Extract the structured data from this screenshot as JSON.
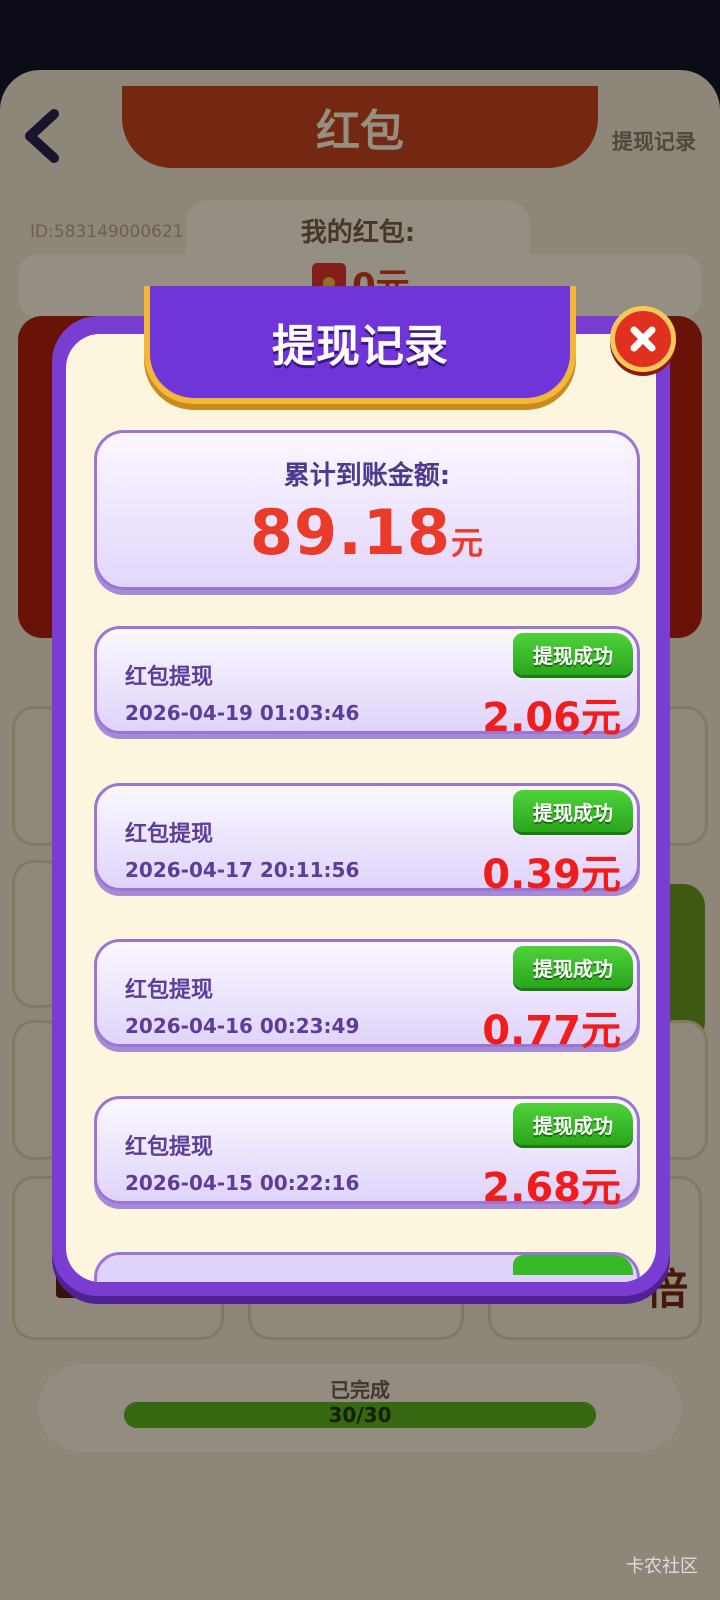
{
  "background": {
    "title": "红包",
    "record_link": "提现记录",
    "user_id": "ID:583149000621",
    "my_red_packet_label": "我的红包:",
    "balance": "0元",
    "big_char": "倍",
    "completed_label": "已完成",
    "progress_text": "30/30",
    "progress_fraction": 1.0
  },
  "modal": {
    "title": "提现记录",
    "total_label": "累计到账金额:",
    "total_value": "89.18",
    "total_unit": "元",
    "records": [
      {
        "title": "红包提现",
        "time": "2026-04-19 01:03:46",
        "amount": "2.06元",
        "status": "提现成功"
      },
      {
        "title": "红包提现",
        "time": "2026-04-17 20:11:56",
        "amount": "0.39元",
        "status": "提现成功"
      },
      {
        "title": "红包提现",
        "time": "2026-04-16 00:23:49",
        "amount": "0.77元",
        "status": "提现成功"
      },
      {
        "title": "红包提现",
        "time": "2026-04-15 00:22:16",
        "amount": "2.68元",
        "status": "提现成功"
      }
    ]
  },
  "watermark": "卡农社区",
  "colors": {
    "modal_border": "#7a3dd1",
    "modal_bg": "#fcf6df",
    "amount_red": "#f01d1d",
    "status_green": "#2aa51c",
    "ribbon_gold": "#f4b73a"
  },
  "icons": {
    "back": "back-chevron-icon",
    "close": "close-x-icon",
    "envelope": "red-envelope-icon"
  }
}
